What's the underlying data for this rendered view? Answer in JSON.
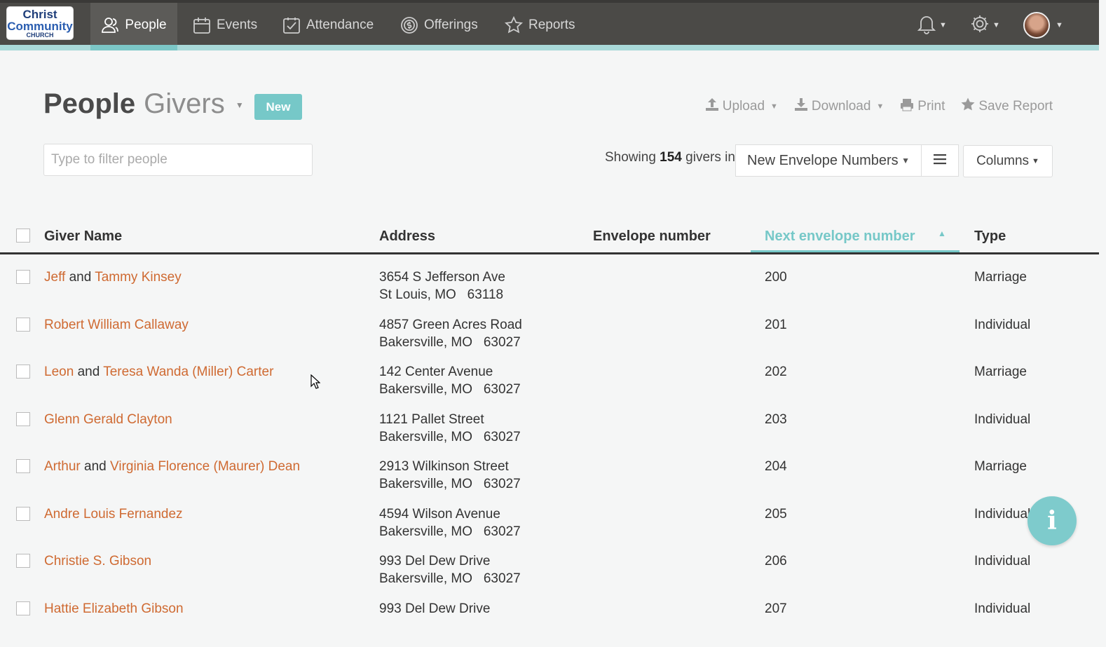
{
  "brand": {
    "line1": "Christ",
    "line2": "Community",
    "line3": "CHURCH"
  },
  "nav": {
    "items": [
      {
        "label": "People",
        "icon": "people-icon"
      },
      {
        "label": "Events",
        "icon": "calendar-icon"
      },
      {
        "label": "Attendance",
        "icon": "checklist-icon"
      },
      {
        "label": "Offerings",
        "icon": "coin-icon"
      },
      {
        "label": "Reports",
        "icon": "star-icon"
      }
    ],
    "active": "People"
  },
  "page": {
    "title": "People",
    "subtitle": "Givers",
    "new_label": "New",
    "actions": {
      "upload": "Upload",
      "download": "Download",
      "print": "Print",
      "save": "Save Report"
    }
  },
  "filter": {
    "placeholder": "Type to filter people",
    "value": ""
  },
  "summary": {
    "prefix": "Showing",
    "count": "154",
    "suffix": "givers in"
  },
  "list_select": {
    "value": "New Envelope Numbers"
  },
  "columns_label": "Columns",
  "table": {
    "headers": {
      "name": "Giver Name",
      "address": "Address",
      "envelope": "Envelope number",
      "next_envelope": "Next envelope number",
      "type": "Type"
    },
    "rows": [
      {
        "names": [
          "Jeff",
          "Tammy Kinsey"
        ],
        "addr1": "3654 S Jefferson Ave",
        "addr2": "St Louis, MO   63118",
        "next": "200",
        "type": "Marriage"
      },
      {
        "names": [
          "Robert William Callaway"
        ],
        "addr1": "4857 Green Acres Road",
        "addr2": "Bakersville, MO   63027",
        "next": "201",
        "type": "Individual"
      },
      {
        "names": [
          "Leon",
          "Teresa Wanda (Miller) Carter"
        ],
        "addr1": "142 Center Avenue",
        "addr2": "Bakersville, MO   63027",
        "next": "202",
        "type": "Marriage"
      },
      {
        "names": [
          "Glenn Gerald Clayton"
        ],
        "addr1": "1121 Pallet Street",
        "addr2": "Bakersville, MO   63027",
        "next": "203",
        "type": "Individual"
      },
      {
        "names": [
          "Arthur",
          "Virginia Florence (Maurer) Dean"
        ],
        "addr1": "2913 Wilkinson Street",
        "addr2": "Bakersville, MO   63027",
        "next": "204",
        "type": "Marriage"
      },
      {
        "names": [
          "Andre Louis Fernandez"
        ],
        "addr1": "4594 Wilson Avenue",
        "addr2": "Bakersville, MO   63027",
        "next": "205",
        "type": "Individual"
      },
      {
        "names": [
          "Christie S. Gibson"
        ],
        "addr1": "993 Del Dew Drive",
        "addr2": "Bakersville, MO   63027",
        "next": "206",
        "type": "Individual"
      },
      {
        "names": [
          "Hattie Elizabeth Gibson"
        ],
        "addr1": "993 Del Dew Drive",
        "addr2": "",
        "next": "207",
        "type": "Individual"
      }
    ],
    "joiner": "and"
  },
  "colors": {
    "accent": "#76c8c8",
    "link": "#cf6a32",
    "nav_bg": "#4b4a47"
  }
}
